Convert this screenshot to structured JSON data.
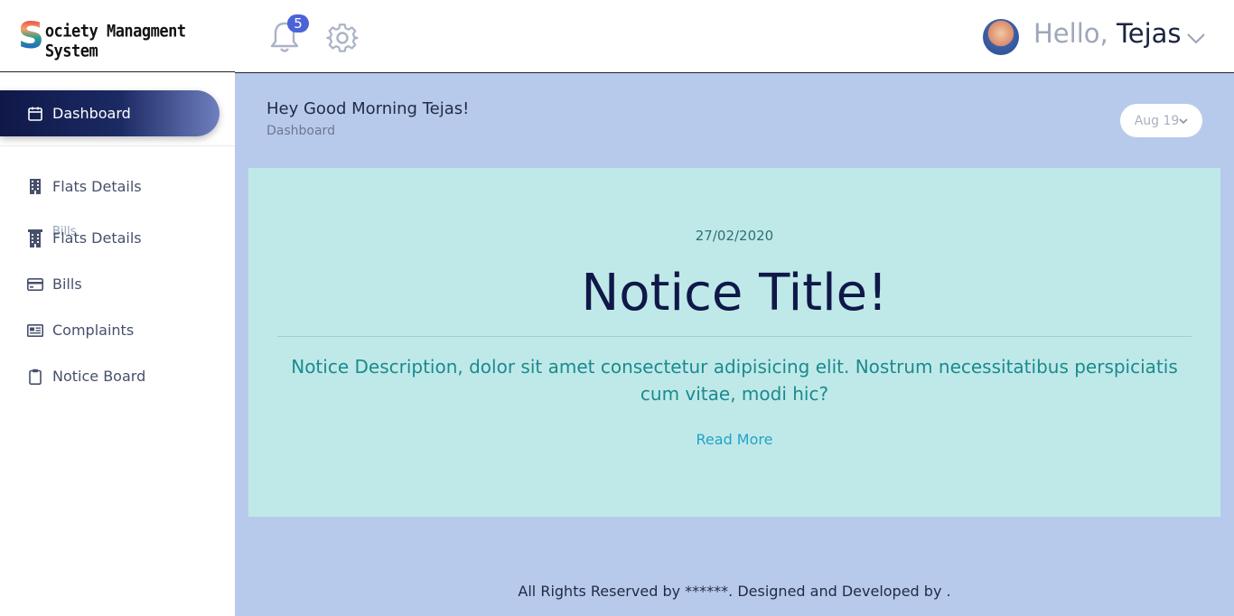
{
  "app": {
    "logo_initial": "S",
    "logo_text": "ociety Managment System"
  },
  "sidebar": {
    "active_item": {
      "label": "Dashboard",
      "icon": "calendar-icon"
    },
    "ghost_label": "Bills",
    "items": [
      {
        "label": "Flats Details",
        "icon": "building-icon"
      },
      {
        "label": "Flats Details",
        "icon": "building-icon"
      },
      {
        "label": "Bills",
        "icon": "credit-card-icon"
      },
      {
        "label": "Complaints",
        "icon": "newspaper-icon"
      },
      {
        "label": "Notice Board",
        "icon": "clipboard-icon"
      }
    ]
  },
  "header": {
    "notification_count": "5",
    "greeting_prefix": "Hello,",
    "user_name": "Tejas"
  },
  "main": {
    "greeting": "Hey Good Morning Tejas!",
    "breadcrumb": "Dashboard",
    "date_selector": "Aug 19"
  },
  "notice": {
    "date": "27/02/2020",
    "title": "Notice Title!",
    "description": "Notice Description, dolor sit amet consectetur adipisicing elit. Nostrum necessitatibus perspiciatis cum vitae, modi hic?",
    "read_more": "Read More"
  },
  "footer": {
    "text": "All Rights Reserved by ******. Designed and Developed by ."
  },
  "colors": {
    "accent": "#0f1848",
    "background": "#b8caeb",
    "card": "#bfe9e8",
    "badge": "#4a63d8",
    "link": "#24a2c8"
  }
}
